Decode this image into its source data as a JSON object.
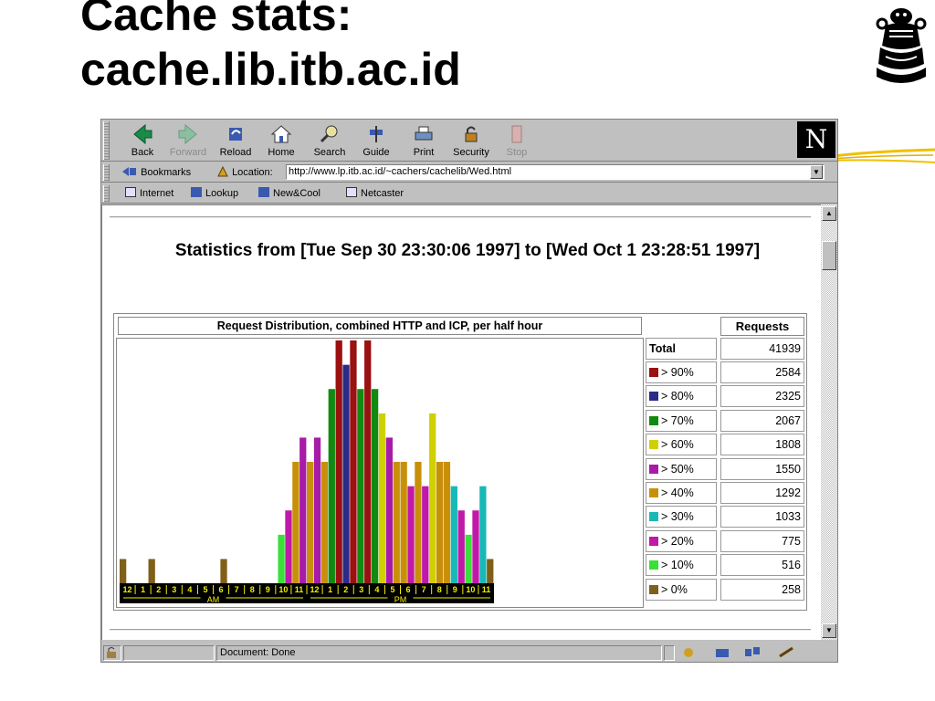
{
  "slide": {
    "title_line1": "Cache stats:",
    "title_line2": "cache.lib.itb.ac.id"
  },
  "browser": {
    "toolbar": [
      {
        "label": "Back",
        "icon": "back-arrow-icon",
        "enabled": true
      },
      {
        "label": "Forward",
        "icon": "forward-arrow-icon",
        "enabled": false
      },
      {
        "label": "Reload",
        "icon": "reload-icon",
        "enabled": true
      },
      {
        "label": "Home",
        "icon": "home-icon",
        "enabled": true
      },
      {
        "label": "Search",
        "icon": "search-icon",
        "enabled": true
      },
      {
        "label": "Guide",
        "icon": "guide-icon",
        "enabled": true
      },
      {
        "label": "Print",
        "icon": "print-icon",
        "enabled": true
      },
      {
        "label": "Security",
        "icon": "security-lock-icon",
        "enabled": true
      },
      {
        "label": "Stop",
        "icon": "stop-icon",
        "enabled": false
      }
    ],
    "brand_letter": "N",
    "bookmarks_label": "Bookmarks",
    "location_label": "Location:",
    "location_url": "http://www.lp.itb.ac.id/~cachers/cachelib/Wed.html",
    "personal_toolbar": [
      "Internet",
      "Lookup",
      "New&Cool",
      "Netcaster"
    ],
    "status_text": "Document: Done"
  },
  "page": {
    "heading": "Statistics from [Tue Sep 30 23:30:06 1997] to [Wed Oct 1 23:28:51 1997]",
    "chart_title": "Request Distribution, combined HTTP and ICP, per half hour",
    "requests_header": "Requests",
    "total_label": "Total",
    "total_value": "41939",
    "legend_rows": [
      {
        "label": "> 90%",
        "value": "2584",
        "color": "#9b1010"
      },
      {
        "label": "> 80%",
        "value": "2325",
        "color": "#2a2a8a"
      },
      {
        "label": "> 70%",
        "value": "2067",
        "color": "#128a12"
      },
      {
        "label": "> 60%",
        "value": "1808",
        "color": "#d0d000"
      },
      {
        "label": "> 50%",
        "value": "1550",
        "color": "#a81aa8"
      },
      {
        "label": "> 40%",
        "value": "1292",
        "color": "#c8900a"
      },
      {
        "label": "> 30%",
        "value": "1033",
        "color": "#18b8b8"
      },
      {
        "label": "> 20%",
        "value": "775",
        "color": "#c018a8"
      },
      {
        "label": "> 10%",
        "value": "516",
        "color": "#38e038"
      },
      {
        "label": "> 0%",
        "value": "258",
        "color": "#806018"
      }
    ]
  },
  "chart_data": {
    "type": "bar",
    "title": "Request Distribution, combined HTTP and ICP, per half hour",
    "x_hour_labels": [
      "12",
      "1",
      "2",
      "3",
      "4",
      "5",
      "6",
      "7",
      "8",
      "9",
      "10",
      "11",
      "12",
      "1",
      "2",
      "3",
      "4",
      "5",
      "6",
      "7",
      "8",
      "9",
      "10",
      "11"
    ],
    "period_labels": [
      "AM",
      "PM"
    ],
    "values": [
      258,
      0,
      0,
      0,
      258,
      0,
      0,
      0,
      0,
      0,
      0,
      0,
      0,
      0,
      258,
      0,
      0,
      0,
      0,
      0,
      0,
      0,
      516,
      775,
      1292,
      1550,
      1292,
      1550,
      1292,
      2067,
      2584,
      2325,
      2584,
      2067,
      2584,
      2067,
      1808,
      1550,
      1292,
      1292,
      1033,
      1292,
      1033,
      1808,
      1292,
      1292,
      1033,
      775,
      516,
      775,
      1033,
      258
    ],
    "colors": [
      "#806018",
      "#806018",
      "#806018",
      "#806018",
      "#806018",
      "#806018",
      "#806018",
      "#806018",
      "#806018",
      "#806018",
      "#806018",
      "#806018",
      "#806018",
      "#806018",
      "#806018",
      "#806018",
      "#806018",
      "#806018",
      "#806018",
      "#806018",
      "#806018",
      "#806018",
      "#38e038",
      "#c018a8",
      "#c8900a",
      "#a81aa8",
      "#c8900a",
      "#a81aa8",
      "#c8900a",
      "#128a12",
      "#9b1010",
      "#2a2a8a",
      "#9b1010",
      "#128a12",
      "#9b1010",
      "#128a12",
      "#d0d000",
      "#a81aa8",
      "#c8900a",
      "#c8900a",
      "#c018a8",
      "#c8900a",
      "#c018a8",
      "#d0d000",
      "#c8900a",
      "#c8900a",
      "#18b8b8",
      "#c018a8",
      "#38e038",
      "#c018a8",
      "#18b8b8",
      "#806018"
    ],
    "ylim": [
      0,
      2584
    ]
  }
}
